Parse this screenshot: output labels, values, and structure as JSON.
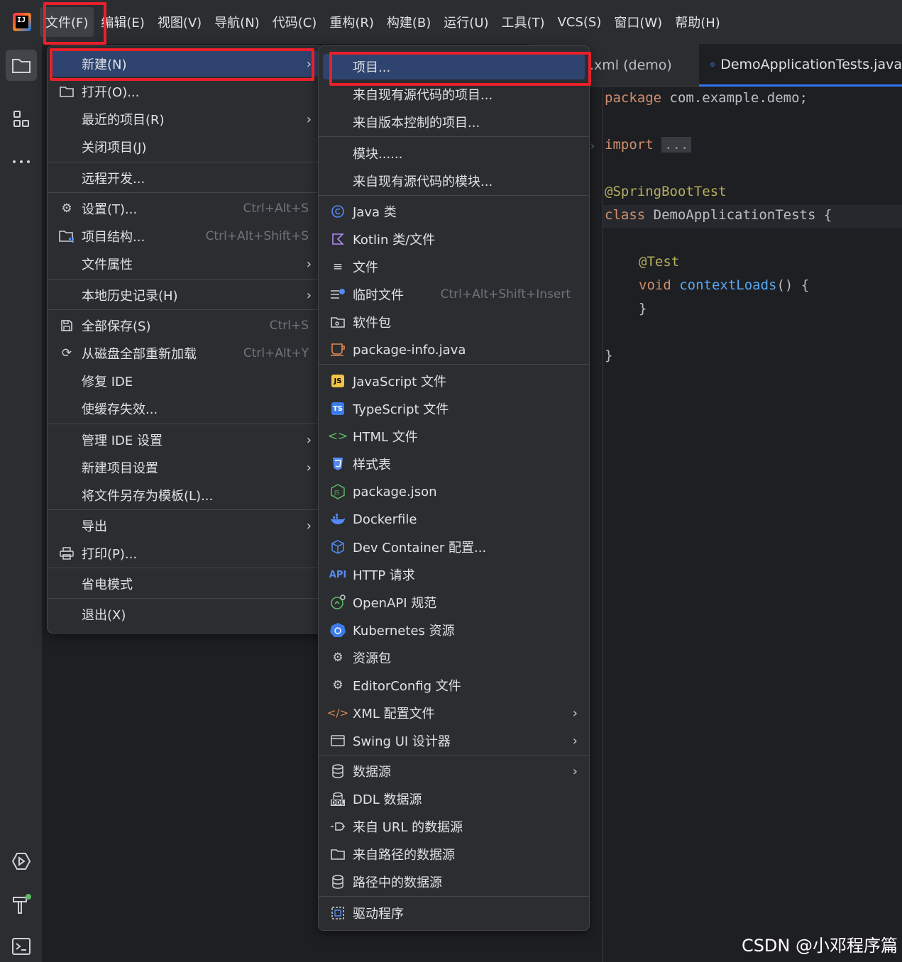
{
  "menubar": {
    "items": [
      "文件(F)",
      "编辑(E)",
      "视图(V)",
      "导航(N)",
      "代码(C)",
      "重构(R)",
      "构建(B)",
      "运行(U)",
      "工具(T)",
      "VCS(S)",
      "窗口(W)",
      "帮助(H)"
    ]
  },
  "editor": {
    "tabs": [
      ".xml (demo)",
      "DemoApplicationTests.java"
    ],
    "code": {
      "package_kw": "package",
      "package_name": " com.example.demo;",
      "import_kw": "import",
      "import_fold": "...",
      "annotation1": "@SpringBootTest",
      "class_kw": "class",
      "class_name": " DemoApplicationTests {",
      "annotation2": "@Test",
      "void_kw": "void",
      "method": " contextLoads",
      "method_rest": "() {",
      "close_method": "}",
      "close_class": "}"
    }
  },
  "file_menu": {
    "items": [
      {
        "label": "新建(N)",
        "icon": "",
        "shortcut": "",
        "submenu": true
      },
      {
        "label": "打开(O)...",
        "icon": "folder-icon",
        "shortcut": "",
        "submenu": false
      },
      {
        "label": "最近的项目(R)",
        "icon": "",
        "shortcut": "",
        "submenu": true
      },
      {
        "label": "关闭项目(J)",
        "icon": "",
        "shortcut": "",
        "submenu": false
      },
      {
        "label": "远程开发...",
        "icon": "",
        "shortcut": "",
        "submenu": false
      },
      {
        "label": "设置(T)...",
        "icon": "gear-icon",
        "shortcut": "Ctrl+Alt+S",
        "submenu": false
      },
      {
        "label": "项目结构...",
        "icon": "project-structure-icon",
        "shortcut": "Ctrl+Alt+Shift+S",
        "submenu": false
      },
      {
        "label": "文件属性",
        "icon": "",
        "shortcut": "",
        "submenu": true
      },
      {
        "label": "本地历史记录(H)",
        "icon": "",
        "shortcut": "",
        "submenu": true
      },
      {
        "label": "全部保存(S)",
        "icon": "save-icon",
        "shortcut": "Ctrl+S",
        "submenu": false
      },
      {
        "label": "从磁盘全部重新加载",
        "icon": "reload-icon",
        "shortcut": "Ctrl+Alt+Y",
        "submenu": false
      },
      {
        "label": "修复 IDE",
        "icon": "",
        "shortcut": "",
        "submenu": false
      },
      {
        "label": "使缓存失效...",
        "icon": "",
        "shortcut": "",
        "submenu": false
      },
      {
        "label": "管理 IDE 设置",
        "icon": "",
        "shortcut": "",
        "submenu": true
      },
      {
        "label": "新建项目设置",
        "icon": "",
        "shortcut": "",
        "submenu": true
      },
      {
        "label": "将文件另存为模板(L)...",
        "icon": "",
        "shortcut": "",
        "submenu": false
      },
      {
        "label": "导出",
        "icon": "",
        "shortcut": "",
        "submenu": true
      },
      {
        "label": "打印(P)...",
        "icon": "printer-icon",
        "shortcut": "",
        "submenu": false
      },
      {
        "label": "省电模式",
        "icon": "",
        "shortcut": "",
        "submenu": false
      },
      {
        "label": "退出(X)",
        "icon": "",
        "shortcut": "",
        "submenu": false
      }
    ]
  },
  "new_menu": {
    "items": [
      {
        "label": "项目...",
        "icon": "",
        "shortcut": "",
        "submenu": false
      },
      {
        "label": "来自现有源代码的项目...",
        "icon": "",
        "shortcut": "",
        "submenu": false
      },
      {
        "label": "来自版本控制的项目...",
        "icon": "",
        "shortcut": "",
        "submenu": false
      },
      {
        "label": "模块......",
        "icon": "",
        "shortcut": "",
        "submenu": false
      },
      {
        "label": "来自现有源代码的模块...",
        "icon": "",
        "shortcut": "",
        "submenu": false
      },
      {
        "label": "Java 类",
        "icon": "java-class-icon",
        "shortcut": "",
        "submenu": false
      },
      {
        "label": "Kotlin 类/文件",
        "icon": "kotlin-icon",
        "shortcut": "",
        "submenu": false
      },
      {
        "label": "文件",
        "icon": "file-icon",
        "shortcut": "",
        "submenu": false
      },
      {
        "label": "临时文件",
        "icon": "scratch-file-icon",
        "shortcut": "Ctrl+Alt+Shift+Insert",
        "submenu": false
      },
      {
        "label": "软件包",
        "icon": "package-icon",
        "shortcut": "",
        "submenu": false
      },
      {
        "label": "package-info.java",
        "icon": "package-info-icon",
        "shortcut": "",
        "submenu": false
      },
      {
        "label": "JavaScript 文件",
        "icon": "javascript-icon",
        "shortcut": "",
        "submenu": false
      },
      {
        "label": "TypeScript 文件",
        "icon": "typescript-icon",
        "shortcut": "",
        "submenu": false
      },
      {
        "label": "HTML 文件",
        "icon": "html-icon",
        "shortcut": "",
        "submenu": false
      },
      {
        "label": "样式表",
        "icon": "css-icon",
        "shortcut": "",
        "submenu": false
      },
      {
        "label": "package.json",
        "icon": "nodejs-icon",
        "shortcut": "",
        "submenu": false
      },
      {
        "label": "Dockerfile",
        "icon": "docker-icon",
        "shortcut": "",
        "submenu": false
      },
      {
        "label": "Dev Container 配置...",
        "icon": "dev-container-icon",
        "shortcut": "",
        "submenu": false
      },
      {
        "label": "HTTP 请求",
        "icon": "api-icon",
        "shortcut": "",
        "submenu": false
      },
      {
        "label": "OpenAPI 规范",
        "icon": "openapi-icon",
        "shortcut": "",
        "submenu": false
      },
      {
        "label": "Kubernetes 资源",
        "icon": "kubernetes-icon",
        "shortcut": "",
        "submenu": false
      },
      {
        "label": "资源包",
        "icon": "resource-bundle-icon",
        "shortcut": "",
        "submenu": false
      },
      {
        "label": "EditorConfig 文件",
        "icon": "editorconfig-icon",
        "shortcut": "",
        "submenu": false
      },
      {
        "label": "XML 配置文件",
        "icon": "xml-icon",
        "shortcut": "",
        "submenu": true
      },
      {
        "label": "Swing UI 设计器",
        "icon": "swing-icon",
        "shortcut": "",
        "submenu": true
      },
      {
        "label": "数据源",
        "icon": "database-icon",
        "shortcut": "",
        "submenu": true
      },
      {
        "label": "DDL 数据源",
        "icon": "ddl-icon",
        "shortcut": "",
        "submenu": false
      },
      {
        "label": "来自 URL 的数据源",
        "icon": "url-datasource-icon",
        "shortcut": "",
        "submenu": false
      },
      {
        "label": "来自路径的数据源",
        "icon": "folder-icon",
        "shortcut": "",
        "submenu": false
      },
      {
        "label": "路径中的数据源",
        "icon": "database-icon",
        "shortcut": "",
        "submenu": false
      },
      {
        "label": "驱动程序",
        "icon": "driver-icon",
        "shortcut": "",
        "submenu": false
      }
    ]
  },
  "badges": {
    "js": "JS",
    "ts": "TS",
    "api": "API",
    "ddl": "DDL"
  },
  "logo_text": "IJ",
  "watermark": "CSDN @小邓程序篇",
  "colors": {
    "highlight": "#2e436e",
    "annotation_box": "#e8202a",
    "accent": "#3574f0"
  }
}
